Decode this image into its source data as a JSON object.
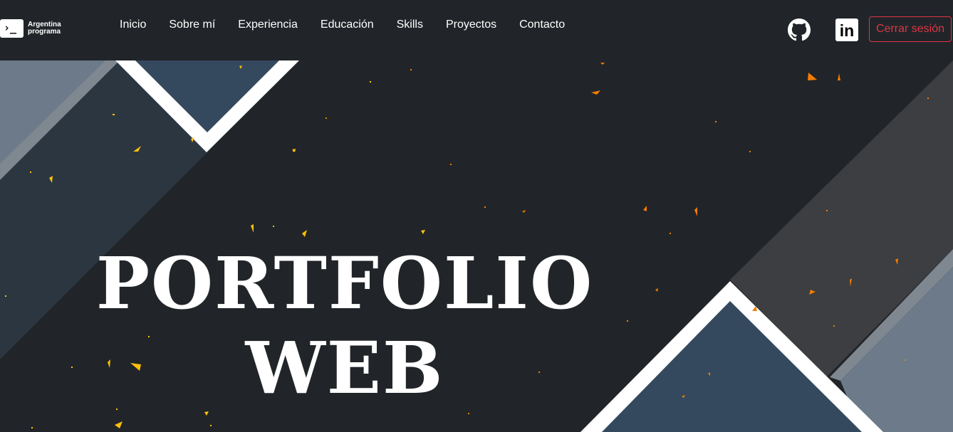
{
  "brand": {
    "icon": "terminal-prompt-icon",
    "prompt": "›_",
    "line1": "Argentina",
    "line2": "programa"
  },
  "nav": {
    "items": [
      {
        "label": "Inicio"
      },
      {
        "label": "Sobre mí"
      },
      {
        "label": "Experiencia"
      },
      {
        "label": "Educación"
      },
      {
        "label": "Skills"
      },
      {
        "label": "Proyectos"
      },
      {
        "label": "Contacto"
      }
    ]
  },
  "social": {
    "github": "github-icon",
    "linkedin": "linkedin-icon",
    "linkedin_text": "in"
  },
  "auth": {
    "logout_label": "Cerrar sesión"
  },
  "hero": {
    "line1": "PORTFOLIO",
    "line2": "WEB"
  },
  "colors": {
    "background": "#212529",
    "danger": "#dc3545",
    "confetti_orange": "#f57c00",
    "confetti_yellow": "#ffc107",
    "slate": "#34495e"
  }
}
